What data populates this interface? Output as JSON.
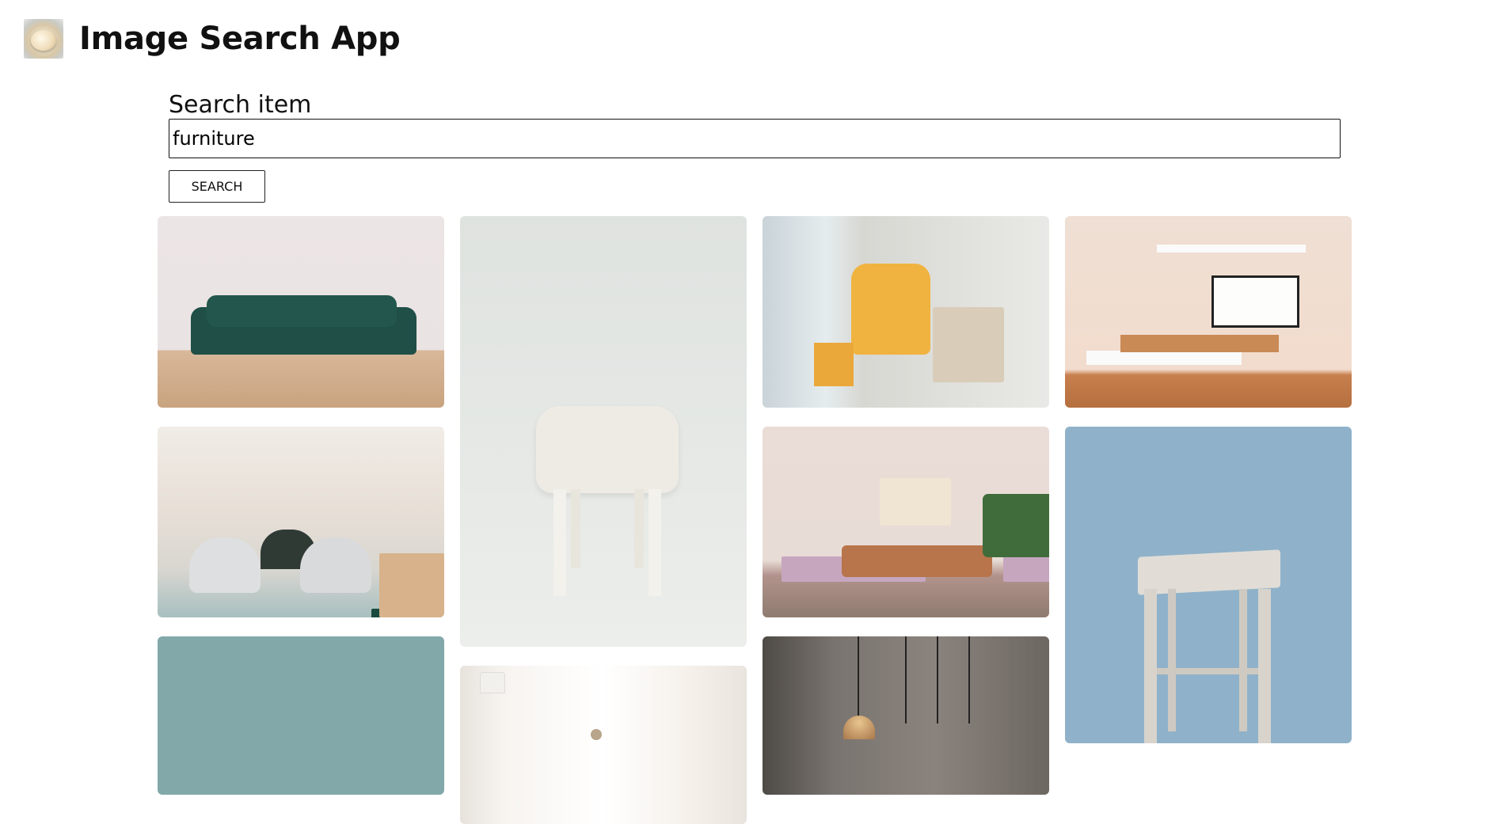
{
  "header": {
    "title": "Image Search App",
    "logo_icon": "ice-cream-bowl-logo"
  },
  "search": {
    "label": "Search item",
    "value": "furniture",
    "button_label": "SEARCH"
  },
  "results": [
    {
      "name": "result-image-green-sofa",
      "subject": "green sofa"
    },
    {
      "name": "result-image-white-chair",
      "subject": "white chair"
    },
    {
      "name": "result-image-yellow-armchair",
      "subject": "yellow armchair"
    },
    {
      "name": "result-image-wall-shelves",
      "subject": "wall shelves"
    },
    {
      "name": "result-image-office-lounge",
      "subject": "office lounge"
    },
    {
      "name": "result-image-pink-living-room",
      "subject": "pink living room"
    },
    {
      "name": "result-image-wooden-stool",
      "subject": "wooden stool"
    },
    {
      "name": "result-image-teal",
      "subject": "teal"
    },
    {
      "name": "result-image-curtain-room",
      "subject": "curtain room"
    },
    {
      "name": "result-image-pendant-lamps",
      "subject": "pendant lamps"
    }
  ]
}
